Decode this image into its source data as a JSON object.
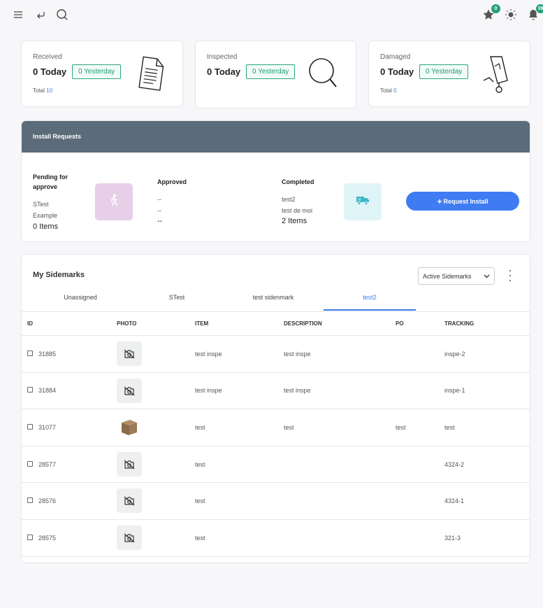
{
  "topbar": {
    "favorites_badge": "0",
    "notifications_badge": "39"
  },
  "stats": [
    {
      "label": "Received",
      "today": "0 Today",
      "yesterday": "0 Yesterday",
      "total_label": "Total",
      "total_value": "10",
      "icon": "document-icon"
    },
    {
      "label": "Inspected",
      "today": "0 Today",
      "yesterday": "0 Yesterday",
      "icon": "magnifier-icon"
    },
    {
      "label": "Damaged",
      "today": "0 Today",
      "yesterday": "0 Yesterday",
      "total_label": "Total",
      "total_value": "0",
      "icon": "broken-glass-icon"
    }
  ],
  "install_requests": {
    "title": "Install Requests",
    "pending": {
      "title": "Pending for approve",
      "lines": [
        "STest",
        "Example"
      ],
      "count": "0 Items"
    },
    "approved": {
      "title": "Approved",
      "lines": [
        "--",
        "--"
      ],
      "count": "--"
    },
    "completed": {
      "title": "Completed",
      "lines": [
        "test2",
        "test de moi"
      ],
      "count": "2 Items"
    },
    "request_button": "Request Install"
  },
  "sidemarks": {
    "title": "My Sidemarks",
    "filter_selected": "Active Sidemarks",
    "tabs": [
      "Unassigned",
      "STest",
      "test sidenmark",
      "test2"
    ],
    "active_tab": 3,
    "columns": [
      "ID",
      "PHOTO",
      "ITEM",
      "DESCRIPTION",
      "PO",
      "TRACKING"
    ],
    "rows": [
      {
        "id": "31885",
        "photo": "no-photo",
        "item": "test inspe",
        "description": "test inspe",
        "po": "",
        "tracking": "inspe-2"
      },
      {
        "id": "31884",
        "photo": "no-photo",
        "item": "test inspe",
        "description": "test inspe",
        "po": "",
        "tracking": "inspe-1"
      },
      {
        "id": "31077",
        "photo": "box",
        "item": "test",
        "description": "test",
        "po": "test",
        "tracking": "test"
      },
      {
        "id": "28577",
        "photo": "no-photo",
        "item": "test",
        "description": "",
        "po": "",
        "tracking": "4324-2"
      },
      {
        "id": "28576",
        "photo": "no-photo",
        "item": "test",
        "description": "",
        "po": "",
        "tracking": "4324-1"
      },
      {
        "id": "28575",
        "photo": "no-photo",
        "item": "test",
        "description": "",
        "po": "",
        "tracking": "321-3"
      }
    ]
  },
  "colors": {
    "accent": "#3f7cf3",
    "success": "#2aa67c",
    "header": "#5c6b79"
  }
}
